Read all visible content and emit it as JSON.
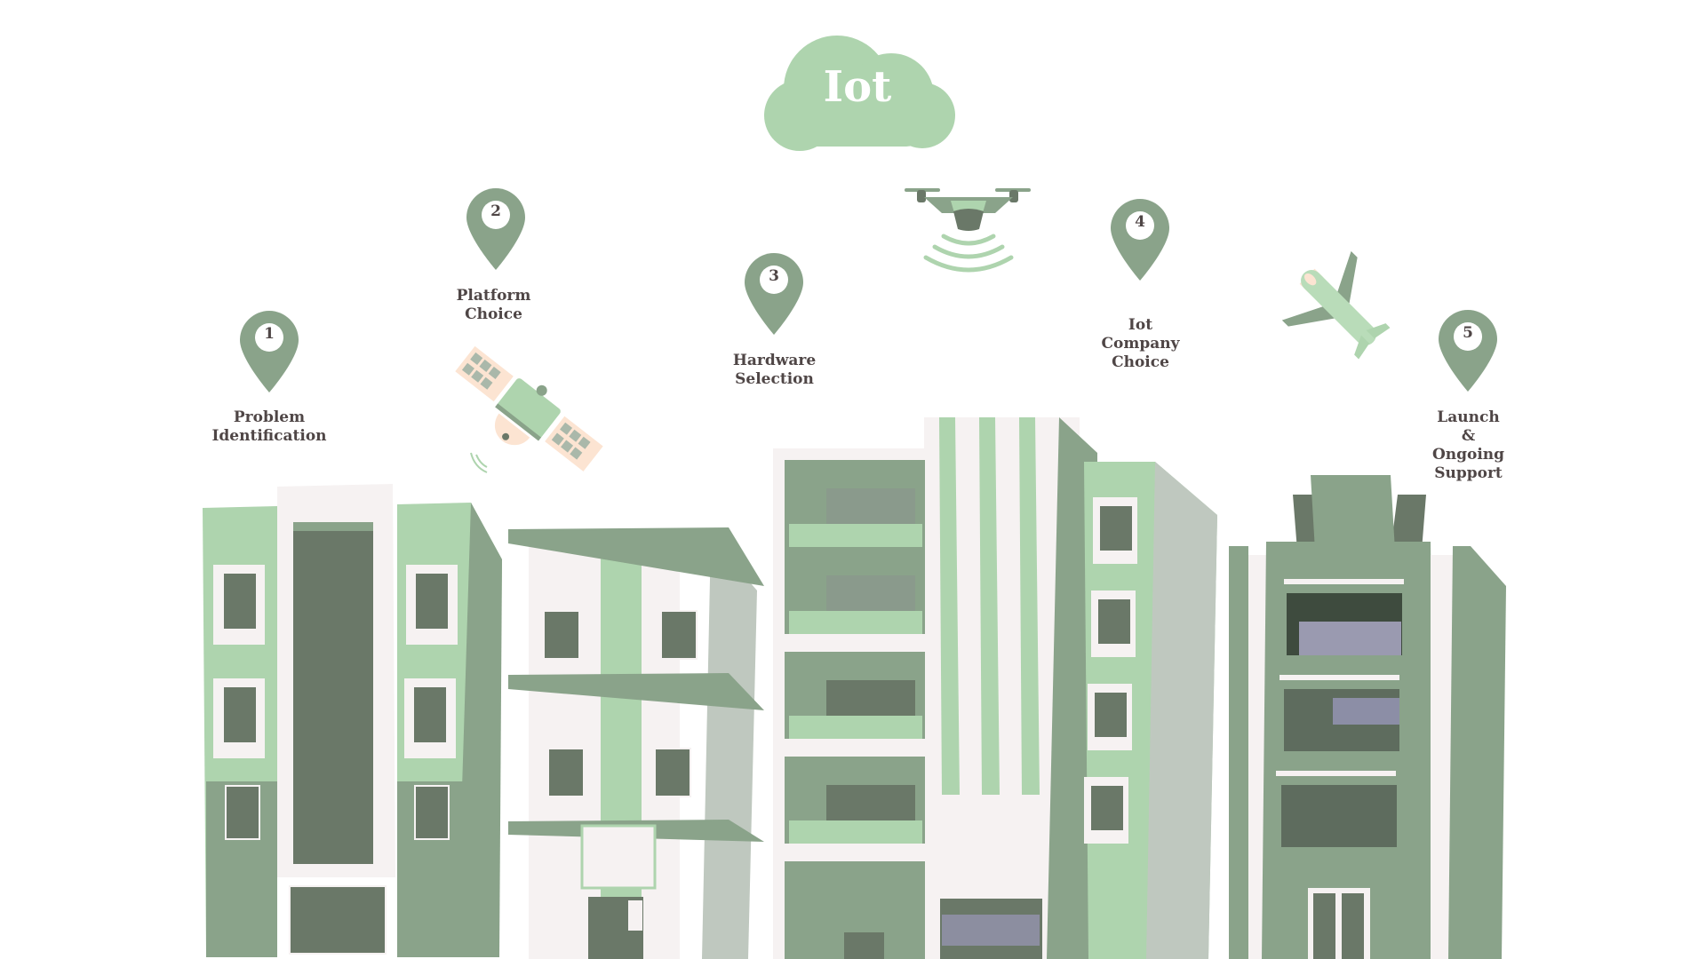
{
  "title": "Iot",
  "colors": {
    "light_green": "#aed4ae",
    "sage": "#8aa38a",
    "dark_sage": "#6a7868",
    "off_white": "#f6f2f2",
    "peach": "#fce4d2",
    "label_text": "#4f4646"
  },
  "steps": [
    {
      "number": "1",
      "label": "Problem\nIdentification"
    },
    {
      "number": "2",
      "label": "Platform\nChoice"
    },
    {
      "number": "3",
      "label": "Hardware\nSelection"
    },
    {
      "number": "4",
      "label": "Iot\nCompany\nChoice"
    },
    {
      "number": "5",
      "label": "Launch\n&\nOngoing\nSupport"
    }
  ],
  "illustrations": [
    "cloud-icon",
    "satellite-icon",
    "drone-icon",
    "airplane-icon",
    "buildings"
  ]
}
